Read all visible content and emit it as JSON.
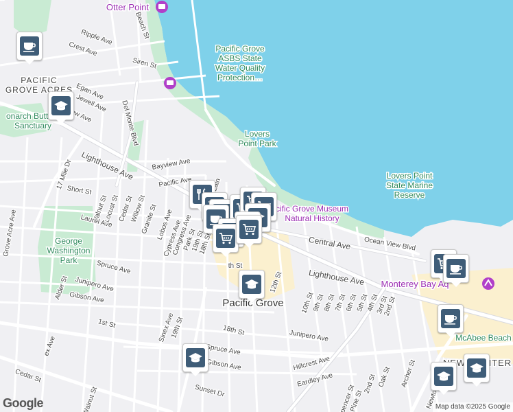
{
  "place_labels": [
    {
      "id": "otter-point",
      "lines": [
        "Otter Point"
      ],
      "color": "#9b2db3"
    },
    {
      "id": "asbs",
      "lines": [
        "Pacific Grove",
        "ASBS State",
        "Water Quality",
        "Protection…"
      ],
      "color": "#2f8a5d"
    },
    {
      "id": "pg-acres",
      "lines": [
        "PACIFIC",
        "GROVE ACRES"
      ],
      "color": "#444444"
    },
    {
      "id": "monarch",
      "lines": [
        "onarch Butterfl",
        "Sanctuary"
      ],
      "color": "#2f8a5d"
    },
    {
      "id": "lovers-point-park",
      "lines": [
        "Lovers",
        "Point Park"
      ],
      "color": "#2f8a5d"
    },
    {
      "id": "lovers-reserve",
      "lines": [
        "Lovers Point",
        "State Marine",
        "Reserve"
      ],
      "color": "#2f8a5d"
    },
    {
      "id": "museum",
      "lines": [
        "cific Grove Museum",
        "Natural History"
      ],
      "color": "#9b2db3"
    },
    {
      "id": "george-washington",
      "lines": [
        "George",
        "Washington",
        "Park"
      ],
      "color": "#2f8a5d"
    },
    {
      "id": "pacific-grove",
      "lines": [
        "Pacific Grove"
      ],
      "color": "#333333"
    },
    {
      "id": "monterey-bay-aq",
      "lines": [
        "Monterey Bay Aq"
      ],
      "color": "#9b2db3"
    },
    {
      "id": "mcabee",
      "lines": [
        "McAbee Beach"
      ],
      "color": "#2f8a5d"
    },
    {
      "id": "new-monterey",
      "lines": [
        "NEW MONTER"
      ],
      "color": "#444444"
    }
  ],
  "street_labels": [
    "Ripple Ave",
    "Beach St",
    "Crest Ave",
    "Siren St",
    "Egan Ave",
    "Jewell Ave",
    "view Ave",
    "Del Monte Blvd",
    "17 Mile Dr",
    "Lighthouse Ave",
    "Bayview Ave",
    "Pacific Ave",
    "Short St",
    "Walnut St",
    "Locust St",
    "Cedar St",
    "Willow St",
    "Granite St",
    "Lobos Ave",
    "Cypress Ave",
    "Congress Ave",
    "Park St",
    "19th St",
    "18th St",
    "Laurel Ave",
    "Grove Acre Ave",
    "Spruce Ave",
    "Junipero Ave",
    "Alder St",
    "Gibson Ave",
    "Central Ave",
    "Ocean View Blvd",
    "Lighthouse Ave",
    "12th St",
    "10th St",
    "9th St",
    "8th St",
    "7th St",
    "6th St",
    "5th St",
    "4th St",
    "3rd St",
    "2nd St",
    "1st St",
    "Sinex Ave",
    "19th St",
    "18th St",
    "Junipero Ave",
    "Spruce Ave",
    "Gibson Ave",
    "ex Ave",
    "Walnut St",
    "Cedar St",
    "Sunset Dr",
    "Hillcrest Ave",
    "Eardley Ave",
    "2nd St",
    "Pine St",
    "Oak St",
    "Archer St",
    "Spencer St",
    "Newton",
    "Lain",
    "th St",
    "La"
  ],
  "pins": [
    {
      "type": "cafe"
    },
    {
      "type": "school"
    },
    {
      "type": "restaurant"
    },
    {
      "type": "shopping"
    },
    {
      "type": "shopping"
    },
    {
      "type": "cafe"
    },
    {
      "type": "shopping"
    },
    {
      "type": "shopping"
    },
    {
      "type": "shopping"
    },
    {
      "type": "school"
    },
    {
      "type": "shopping"
    },
    {
      "type": "cafe"
    },
    {
      "type": "shopping"
    },
    {
      "type": "shopping"
    },
    {
      "type": "shopping"
    },
    {
      "type": "cafe"
    },
    {
      "type": "cafe"
    },
    {
      "type": "school"
    },
    {
      "type": "school"
    },
    {
      "type": "school"
    },
    {
      "type": "school"
    }
  ],
  "google_logo": "Google",
  "attribution": "Map data ©2025 Google",
  "colors": {
    "water": "#7fd1ea",
    "land": "#f0f0f3",
    "park": "#c9ebd3",
    "road": "#ffffff",
    "major_road": "#d8d9de",
    "commercial": "#fbf0cf",
    "pin_icon": "#3f5d78",
    "poi_purple": "#b13fc9"
  }
}
